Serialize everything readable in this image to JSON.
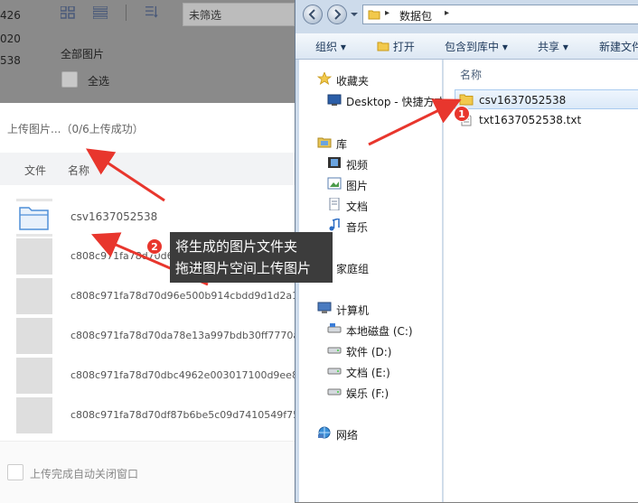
{
  "bg_page": {
    "numbers": [
      "426",
      "020",
      "538"
    ],
    "filter_value": "未筛选",
    "section_label": "全部图片",
    "select_all": "全选"
  },
  "upload_dialog": {
    "title": "上传图片...（0/6上传成功）",
    "columns": [
      "文件",
      "名称"
    ],
    "rows": [
      "csv1637052538",
      "c808c971fa78d70d6d5e1b6e6c0d08e1e8fb6a79e",
      "c808c971fa78d70d96e500b914cbdd9d1d2a13",
      "c808c971fa78d70da78e13a997bdb30ff7770ab",
      "c808c971fa78d70dbc4962e003017100d9ee8c",
      "c808c971fa78d70df87b6be5c09d7410549f753"
    ],
    "auto_close_label": "上传完成自动关闭窗口"
  },
  "explorer": {
    "address": "数据包",
    "commands": [
      "组织",
      "打开",
      "包含到库中",
      "共享",
      "新建文件夹"
    ],
    "nav": {
      "favorites": "收藏夹",
      "desktop": "Desktop - 快捷方式",
      "libraries": "库",
      "videos": "视频",
      "pictures": "图片",
      "documents": "文档",
      "music": "音乐",
      "homegroup": "家庭组",
      "computer": "计算机",
      "drive_c": "本地磁盘 (C:)",
      "drive_d": "软件 (D:)",
      "drive_e": "文档 (E:)",
      "drive_f": "娱乐 (F:)",
      "network": "网络"
    },
    "column_header": "名称",
    "files": [
      {
        "name": "csv1637052538",
        "icon": "folder-icon",
        "selected": true
      },
      {
        "name": "txt1637052538.txt",
        "icon": "text-file-icon",
        "selected": false
      }
    ]
  },
  "annotations": {
    "badge1": "1",
    "badge2": "2",
    "callout_lines": [
      "将生成的图片文件夹",
      "拖进图片空间上传图片"
    ],
    "arrow_color": "#e8362d"
  }
}
